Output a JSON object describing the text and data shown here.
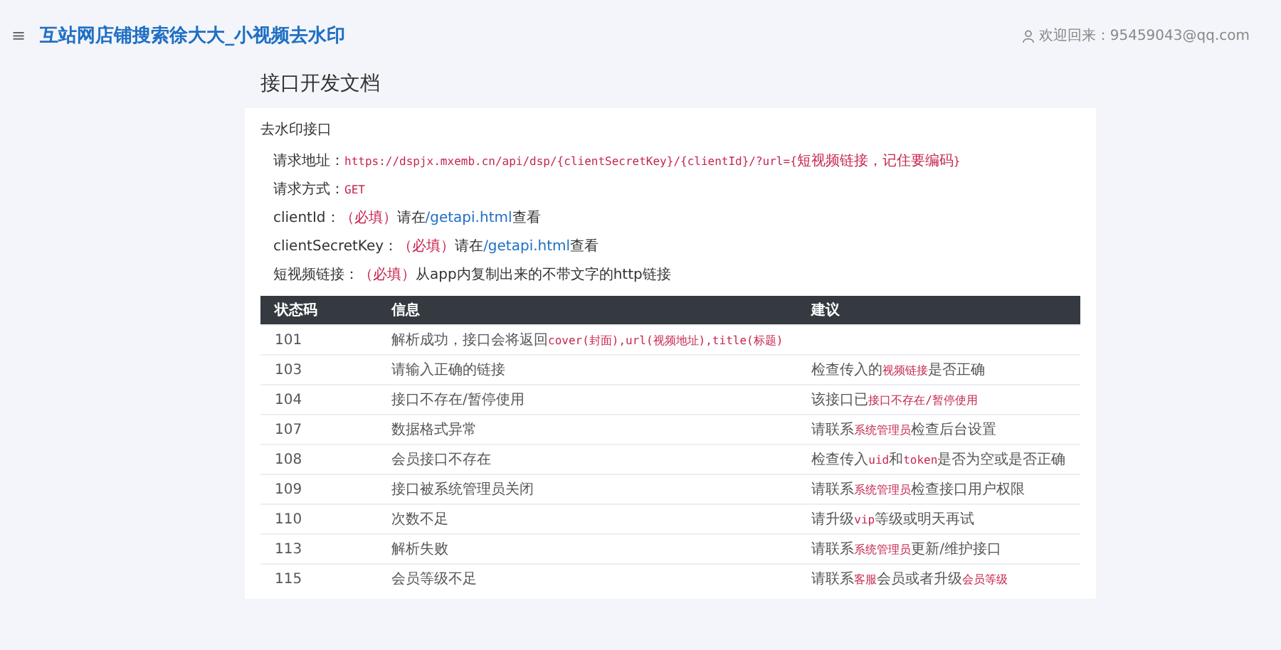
{
  "header": {
    "menu_icon": "≡",
    "title": "互站网店铺搜索徐大大_小视频去水印",
    "user": "欢迎回来：95459043@qq.com"
  },
  "page_title": "接口开发文档",
  "card": {
    "title": "去水印接口",
    "params": [
      {
        "label": "请求地址：",
        "parts": [
          {
            "kind": "code",
            "text": "https://dspjx.mxemb.cn/api/dsp/{clientSecretKey}/{clientId}/?url={"
          },
          {
            "kind": "mark",
            "text": "短视频链接，记住要编码"
          },
          {
            "kind": "code",
            "text": "}"
          }
        ]
      },
      {
        "label": "请求方式：",
        "parts": [
          {
            "kind": "code",
            "text": "GET"
          }
        ]
      },
      {
        "label": "clientId：",
        "parts": [
          {
            "kind": "mark",
            "text": "（必填）"
          },
          {
            "kind": "text",
            "text": "请在"
          },
          {
            "kind": "link",
            "text": "/getapi.html"
          },
          {
            "kind": "text",
            "text": "查看"
          }
        ]
      },
      {
        "label": "clientSecretKey：",
        "parts": [
          {
            "kind": "mark",
            "text": "（必填）"
          },
          {
            "kind": "text",
            "text": "请在"
          },
          {
            "kind": "link",
            "text": "/getapi.html"
          },
          {
            "kind": "text",
            "text": "查看"
          }
        ]
      },
      {
        "label": "短视频链接：",
        "parts": [
          {
            "kind": "mark",
            "text": "（必填）"
          },
          {
            "kind": "text",
            "text": "从app内复制出来的不带文字的http链接"
          }
        ]
      }
    ],
    "table": {
      "columns": [
        "状态码",
        "信息",
        "建议"
      ],
      "rows": [
        {
          "code": "101",
          "info": [
            {
              "kind": "text",
              "text": "解析成功，接口会将返回"
            },
            {
              "kind": "code",
              "text": "cover(封面),url(视频地址),title(标题)"
            }
          ],
          "advice": []
        },
        {
          "code": "103",
          "info": [
            {
              "kind": "text",
              "text": "请输入正确的链接"
            }
          ],
          "advice": [
            {
              "kind": "text",
              "text": "检查传入的"
            },
            {
              "kind": "code",
              "text": "视频链接"
            },
            {
              "kind": "text",
              "text": "是否正确"
            }
          ]
        },
        {
          "code": "104",
          "info": [
            {
              "kind": "text",
              "text": "接口不存在/暂停使用"
            }
          ],
          "advice": [
            {
              "kind": "text",
              "text": "该接口已"
            },
            {
              "kind": "code",
              "text": "接口不存在/暂停使用"
            }
          ]
        },
        {
          "code": "107",
          "info": [
            {
              "kind": "text",
              "text": "数据格式异常"
            }
          ],
          "advice": [
            {
              "kind": "text",
              "text": "请联系"
            },
            {
              "kind": "code",
              "text": "系统管理员"
            },
            {
              "kind": "text",
              "text": "检查后台设置"
            }
          ]
        },
        {
          "code": "108",
          "info": [
            {
              "kind": "text",
              "text": "会员接口不存在"
            }
          ],
          "advice": [
            {
              "kind": "text",
              "text": "检查传入"
            },
            {
              "kind": "code",
              "text": "uid"
            },
            {
              "kind": "text",
              "text": "和"
            },
            {
              "kind": "code",
              "text": "token"
            },
            {
              "kind": "text",
              "text": "是否为空或是否正确"
            }
          ]
        },
        {
          "code": "109",
          "info": [
            {
              "kind": "text",
              "text": "接口被系统管理员关闭"
            }
          ],
          "advice": [
            {
              "kind": "text",
              "text": "请联系"
            },
            {
              "kind": "code",
              "text": "系统管理员"
            },
            {
              "kind": "text",
              "text": "检查接口用户权限"
            }
          ]
        },
        {
          "code": "110",
          "info": [
            {
              "kind": "text",
              "text": "次数不足"
            }
          ],
          "advice": [
            {
              "kind": "text",
              "text": "请升级"
            },
            {
              "kind": "code",
              "text": "vip"
            },
            {
              "kind": "text",
              "text": "等级或明天再试"
            }
          ]
        },
        {
          "code": "113",
          "info": [
            {
              "kind": "text",
              "text": "解析失败"
            }
          ],
          "advice": [
            {
              "kind": "text",
              "text": "请联系"
            },
            {
              "kind": "code",
              "text": "系统管理员"
            },
            {
              "kind": "text",
              "text": "更新/维护接口"
            }
          ]
        },
        {
          "code": "115",
          "info": [
            {
              "kind": "text",
              "text": "会员等级不足"
            }
          ],
          "advice": [
            {
              "kind": "text",
              "text": "请联系"
            },
            {
              "kind": "code",
              "text": "客服"
            },
            {
              "kind": "text",
              "text": "会员或者升级"
            },
            {
              "kind": "code",
              "text": "会员等级"
            }
          ]
        }
      ]
    }
  }
}
